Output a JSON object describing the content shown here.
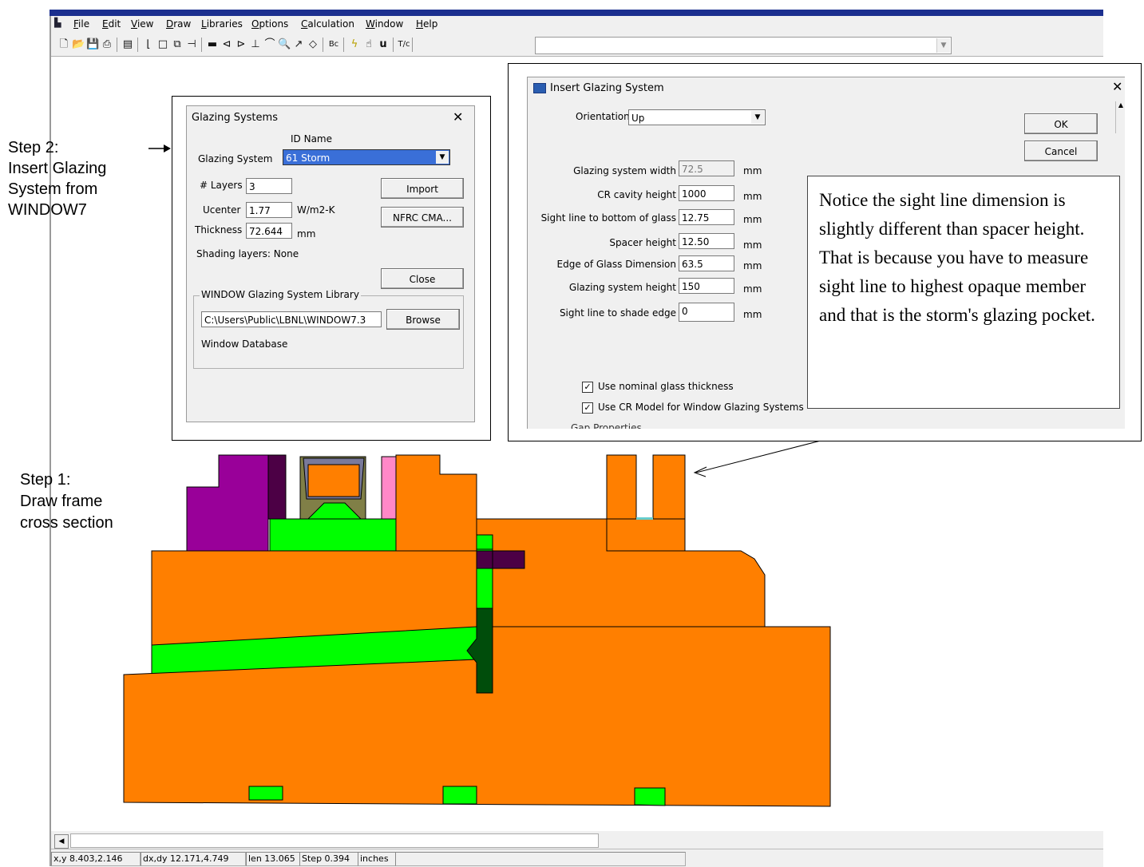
{
  "menu": [
    "File",
    "Edit",
    "View",
    "Draw",
    "Libraries",
    "Options",
    "Calculation",
    "Window",
    "Help"
  ],
  "toolbar": {
    "icons": [
      "new-file-icon",
      "open-file-icon",
      "save-icon",
      "print-icon",
      "properties-icon",
      "polygon-icon",
      "rectangle-icon",
      "fill-void-icon",
      "locator-icon",
      "material-icon",
      "boundary-condition-icon",
      "flip-icon",
      "insert-icon",
      "arc-icon",
      "zoom-icon",
      "pick-icon",
      "fill-icon",
      "bc-icon",
      "calculate-icon",
      "display-icon",
      "u-factor-icon",
      "temperature-icon"
    ],
    "combo_value": ""
  },
  "annotations": {
    "step2": [
      "Step 2:",
      "Insert Glazing",
      "System from",
      "WINDOW7"
    ],
    "step1": [
      "Step 1:",
      "Draw frame",
      "cross section"
    ],
    "note": "Notice the sight line dimension is slightly different than spacer height. That is because you have to measure sight line to highest opaque member and that is the storm's glazing pocket."
  },
  "glazing_systems_dialog": {
    "title": "Glazing Systems",
    "col_header": "ID Name",
    "system_label": "Glazing System",
    "system_value": "61 Storm",
    "layers_label": "# Layers",
    "layers_value": "3",
    "ucenter_label": "Ucenter",
    "ucenter_value": "1.77",
    "ucenter_unit": "W/m2-K",
    "thickness_label": "Thickness",
    "thickness_value": "72.644",
    "thickness_unit": "mm",
    "shading_label": "Shading layers:  None",
    "import_btn": "Import",
    "nfrc_btn": "NFRC CMA...",
    "close_btn": "Close",
    "library_group": "WINDOW Glazing System Library",
    "library_path": "C:\\Users\\Public\\LBNL\\WINDOW7.3",
    "browse_btn": "Browse",
    "database_label": "Window Database"
  },
  "insert_glazing_dialog": {
    "title": "Insert Glazing System",
    "orientation_label": "Orientation",
    "orientation_value": "Up",
    "ok_btn": "OK",
    "cancel_btn": "Cancel",
    "fields": [
      {
        "label": "Glazing system width",
        "value": "72.5",
        "unit": "mm",
        "disabled": true
      },
      {
        "label": "CR cavity height",
        "value": "1000",
        "unit": "mm"
      },
      {
        "label": "Sight line to bottom of glass",
        "value": "12.75",
        "unit": "mm"
      },
      {
        "label": "Spacer height",
        "value": "12.50",
        "unit": "mm"
      },
      {
        "label": "Edge of Glass Dimension",
        "value": "63.5",
        "unit": "mm"
      },
      {
        "label": "Glazing system height",
        "value": "150",
        "unit": "mm"
      },
      {
        "label": "Sight line to shade edge",
        "value": "0",
        "unit": "mm"
      }
    ],
    "check1": "Use nominal glass thickness",
    "check2": "Use CR Model for Window Glazing Systems",
    "cut_label": "Gap Properties"
  },
  "status": {
    "xy": "x,y 8.403,2.146",
    "dxdy": "dx,dy 12.171,4.749",
    "len": "len 13.065",
    "step": "Step 0.394",
    "units": "inches"
  },
  "colors": {
    "orange": "#ff7f00",
    "green": "#00ff00",
    "purple": "#990099",
    "dark_purple": "#4c0045",
    "olive": "#807f47",
    "pink": "#ff88c8",
    "dark_green": "#004d0b"
  }
}
